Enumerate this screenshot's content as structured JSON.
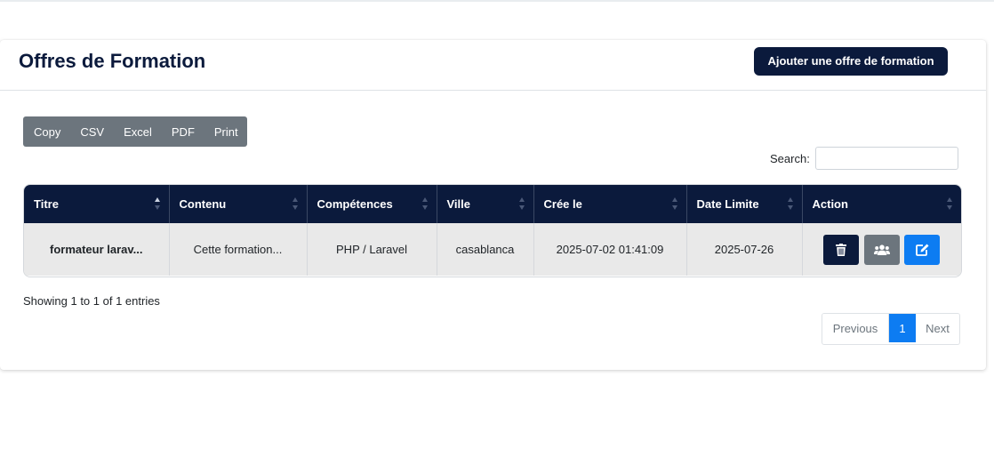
{
  "page": {
    "title": "Offres de Formation",
    "add_button": "Ajouter une offre de formation"
  },
  "toolbar": {
    "export_buttons": [
      "Copy",
      "CSV",
      "Excel",
      "PDF",
      "Print"
    ],
    "search_label": "Search:",
    "search_value": ""
  },
  "table": {
    "columns": [
      "Titre",
      "Contenu",
      "Compétences",
      "Ville",
      "Crée le",
      "Date Limite",
      "Action"
    ],
    "sorted_column": "Titre",
    "rows": [
      {
        "titre": "formateur larav...",
        "contenu": "Cette formation...",
        "competences": "PHP / Laravel",
        "ville": "casablanca",
        "cree_le": "2025-07-02 01:41:09",
        "date_limite": "2025-07-26",
        "actions": [
          "trash-icon",
          "users-icon",
          "edit-icon"
        ]
      }
    ]
  },
  "footer": {
    "info": "Showing 1 to 1 of 1 entries",
    "pagination": {
      "previous": "Previous",
      "current": "1",
      "next": "Next"
    }
  },
  "colors": {
    "primary_dark": "#0b1a3c",
    "secondary": "#6c757d",
    "accent_blue": "#0d7cf2",
    "row_bg": "#e9e9e9"
  }
}
